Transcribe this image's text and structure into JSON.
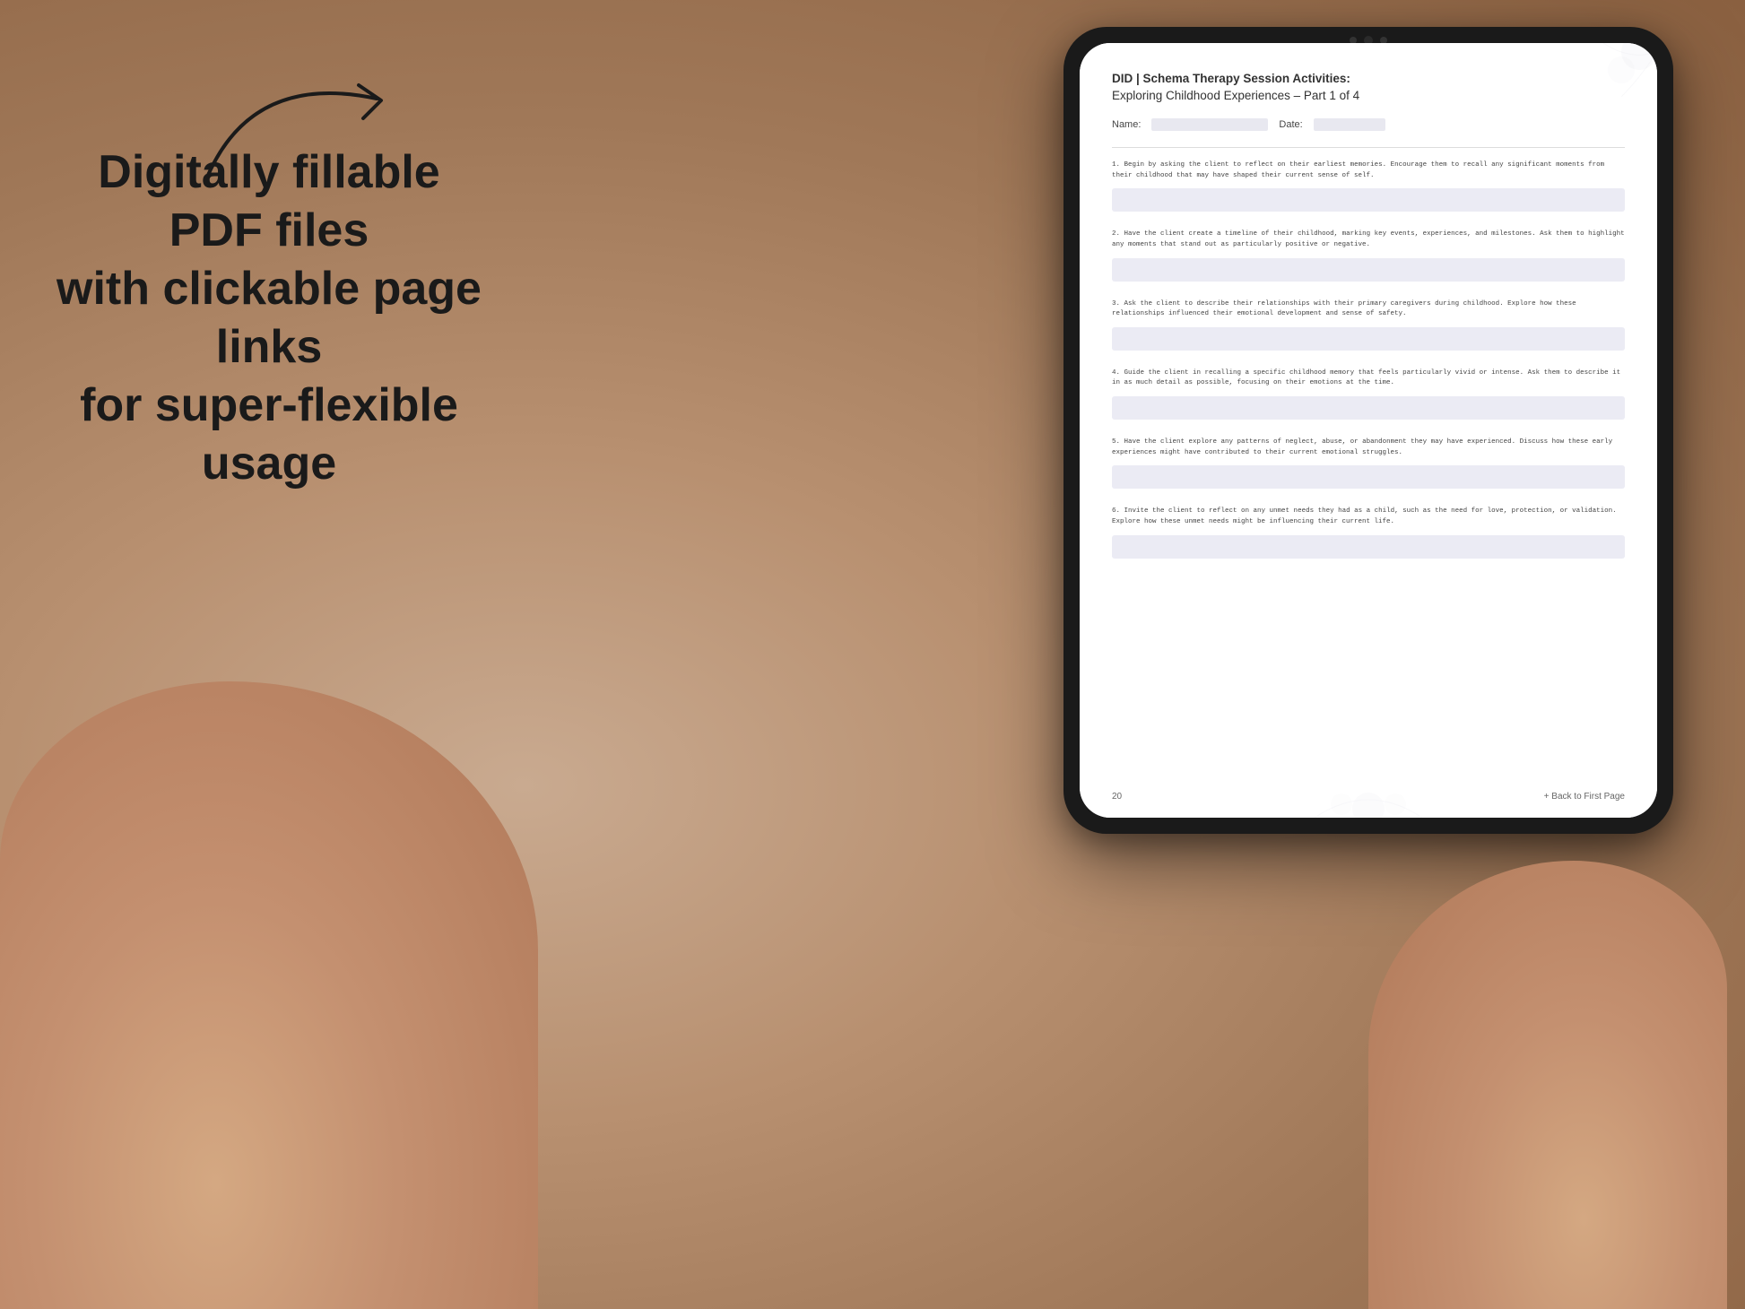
{
  "background": {
    "color": "#b8a08a"
  },
  "left_panel": {
    "main_text": "Digitally fillable PDF files\nwith clickable page links\nfor super-flexible usage",
    "arrow_label": "arrow pointing right"
  },
  "tablet": {
    "document": {
      "title": "DID | Schema Therapy Session Activities:",
      "subtitle": "Exploring Childhood Experiences  – Part 1 of 4",
      "name_label": "Name:",
      "date_label": "Date:",
      "items": [
        {
          "number": "1.",
          "text": "Begin by asking the client to reflect on their earliest memories. Encourage them to recall any significant moments from their childhood that may have shaped their current sense of self."
        },
        {
          "number": "2.",
          "text": "Have the client create a timeline of their childhood, marking key events, experiences, and milestones. Ask them to highlight any moments that stand out as particularly positive or negative."
        },
        {
          "number": "3.",
          "text": "Ask the client to describe their relationships with their primary caregivers during childhood. Explore how these relationships influenced their emotional development and sense of safety."
        },
        {
          "number": "4.",
          "text": "Guide the client in recalling a specific childhood memory that feels particularly vivid or intense. Ask them to describe it in as much detail as possible, focusing on their emotions at the time."
        },
        {
          "number": "5.",
          "text": "Have the client explore any patterns of neglect, abuse, or abandonment they may have experienced. Discuss how these early experiences might have contributed to their current emotional struggles."
        },
        {
          "number": "6.",
          "text": "Invite the client to reflect on any unmet needs they had as a child, such as the need for love, protection, or validation. Explore how these unmet needs might be influencing their current life."
        }
      ],
      "page_number": "20",
      "back_link": "+ Back to First Page"
    }
  }
}
